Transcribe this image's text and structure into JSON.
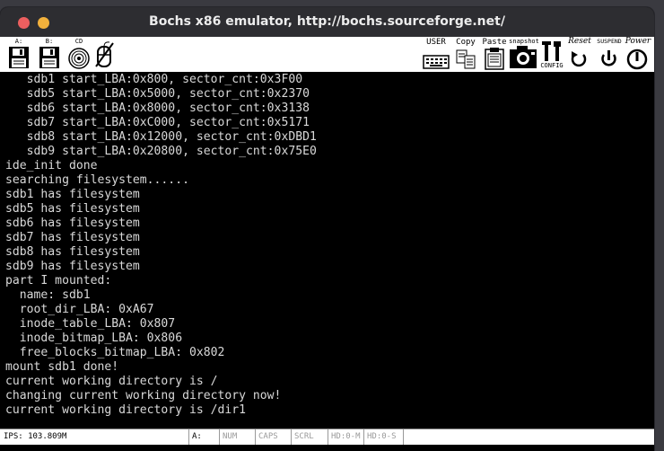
{
  "window": {
    "title": "Bochs x86 emulator, http://bochs.sourceforge.net/"
  },
  "toolbar": {
    "floppy_a": "A:",
    "floppy_b": "B:",
    "cdrom": "CD",
    "user": "USER",
    "copy": "Copy",
    "paste": "Paste",
    "snapshot": "snapshot",
    "config": "CONFIG",
    "reset": "Reset",
    "suspend": "SUSPEND",
    "power": "Power"
  },
  "console": {
    "lines": [
      "   sdb1 start_LBA:0x800, sector_cnt:0x3F00",
      "   sdb5 start_LBA:0x5000, sector_cnt:0x2370",
      "   sdb6 start_LBA:0x8000, sector_cnt:0x3138",
      "   sdb7 start_LBA:0xC000, sector_cnt:0x5171",
      "   sdb8 start_LBA:0x12000, sector_cnt:0xDBD1",
      "   sdb9 start_LBA:0x20800, sector_cnt:0x75E0",
      "ide_init done",
      "searching filesystem......",
      "sdb1 has filesystem",
      "sdb5 has filesystem",
      "sdb6 has filesystem",
      "sdb7 has filesystem",
      "sdb8 has filesystem",
      "sdb9 has filesystem",
      "part I mounted:",
      "  name: sdb1",
      "  root_dir_LBA: 0xA67",
      "  inode_table_LBA: 0x807",
      "  inode_bitmap_LBA: 0x806",
      "  free_blocks_bitmap_LBA: 0x802",
      "mount sdb1 done!",
      "current working directory is /",
      "changing current working directory now!",
      "current working directory is /dir1"
    ]
  },
  "status": {
    "ips": "IPS: 103.809M",
    "drive": "A:",
    "num": "NUM",
    "caps": "CAPS",
    "scrl": "SCRL",
    "hd0m": "HD:0-M",
    "hd0s": "HD:0-S"
  }
}
